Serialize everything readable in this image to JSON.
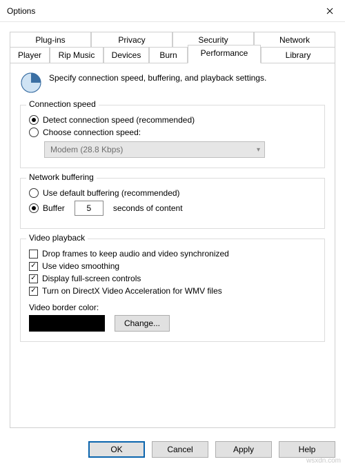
{
  "window": {
    "title": "Options"
  },
  "tabs": {
    "row1": [
      "Plug-ins",
      "Privacy",
      "Security",
      "Network"
    ],
    "row2": [
      "Player",
      "Rip Music",
      "Devices",
      "Burn",
      "Performance",
      "Library"
    ],
    "active": "Performance"
  },
  "intro": "Specify connection speed, buffering, and playback settings.",
  "connection": {
    "legend": "Connection speed",
    "detect": {
      "label": "Detect connection speed (recommended)",
      "checked": true
    },
    "choose": {
      "label": "Choose connection speed:",
      "checked": false
    },
    "combo_value": "Modem (28.8 Kbps)"
  },
  "buffering": {
    "legend": "Network buffering",
    "default": {
      "label": "Use default buffering (recommended)",
      "checked": false
    },
    "buffer": {
      "label": "Buffer",
      "checked": true,
      "value": "5",
      "suffix": "seconds of content"
    }
  },
  "video": {
    "legend": "Video playback",
    "drop": {
      "label": "Drop frames to keep audio and video synchronized",
      "checked": false
    },
    "smooth": {
      "label": "Use video smoothing",
      "checked": true
    },
    "fullscreen": {
      "label": "Display full-screen controls",
      "checked": true
    },
    "directx": {
      "label": "Turn on DirectX Video Acceleration for WMV files",
      "checked": true
    },
    "border_label": "Video border color:",
    "border_color": "#000000",
    "change": "Change..."
  },
  "footer": {
    "ok": "OK",
    "cancel": "Cancel",
    "apply": "Apply",
    "help": "Help"
  },
  "watermark": "wsxdn.com"
}
